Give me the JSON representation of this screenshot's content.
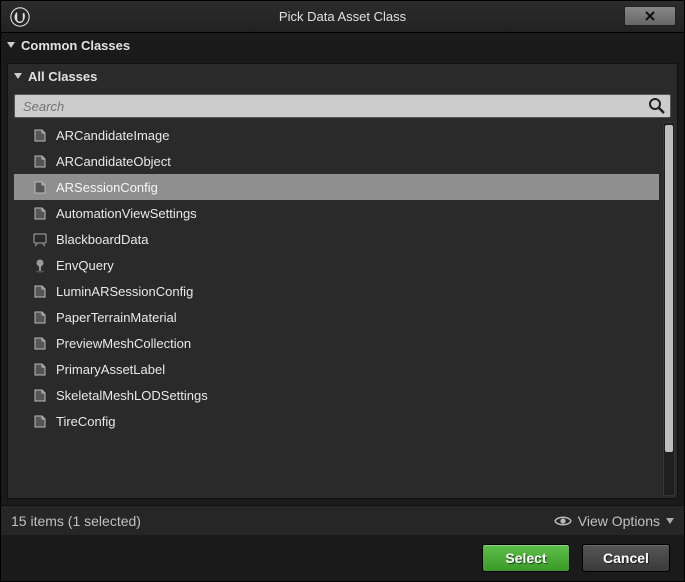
{
  "window": {
    "title": "Pick Data Asset Class"
  },
  "sections": {
    "common": "Common Classes",
    "all": "All Classes"
  },
  "search": {
    "placeholder": "Search"
  },
  "classes": [
    {
      "name": "ARCandidateImage",
      "icon": "asset",
      "selected": false
    },
    {
      "name": "ARCandidateObject",
      "icon": "asset",
      "selected": false
    },
    {
      "name": "ARSessionConfig",
      "icon": "asset",
      "selected": true
    },
    {
      "name": "AutomationViewSettings",
      "icon": "asset",
      "selected": false
    },
    {
      "name": "BlackboardData",
      "icon": "blackboard",
      "selected": false
    },
    {
      "name": "EnvQuery",
      "icon": "envquery",
      "selected": false
    },
    {
      "name": "LuminARSessionConfig",
      "icon": "asset",
      "selected": false
    },
    {
      "name": "PaperTerrainMaterial",
      "icon": "asset",
      "selected": false
    },
    {
      "name": "PreviewMeshCollection",
      "icon": "asset",
      "selected": false
    },
    {
      "name": "PrimaryAssetLabel",
      "icon": "asset",
      "selected": false
    },
    {
      "name": "SkeletalMeshLODSettings",
      "icon": "asset",
      "selected": false
    },
    {
      "name": "TireConfig",
      "icon": "asset",
      "selected": false
    }
  ],
  "status": {
    "count_text": "15 items (1 selected)",
    "view_options": "View Options"
  },
  "buttons": {
    "select": "Select",
    "cancel": "Cancel"
  }
}
